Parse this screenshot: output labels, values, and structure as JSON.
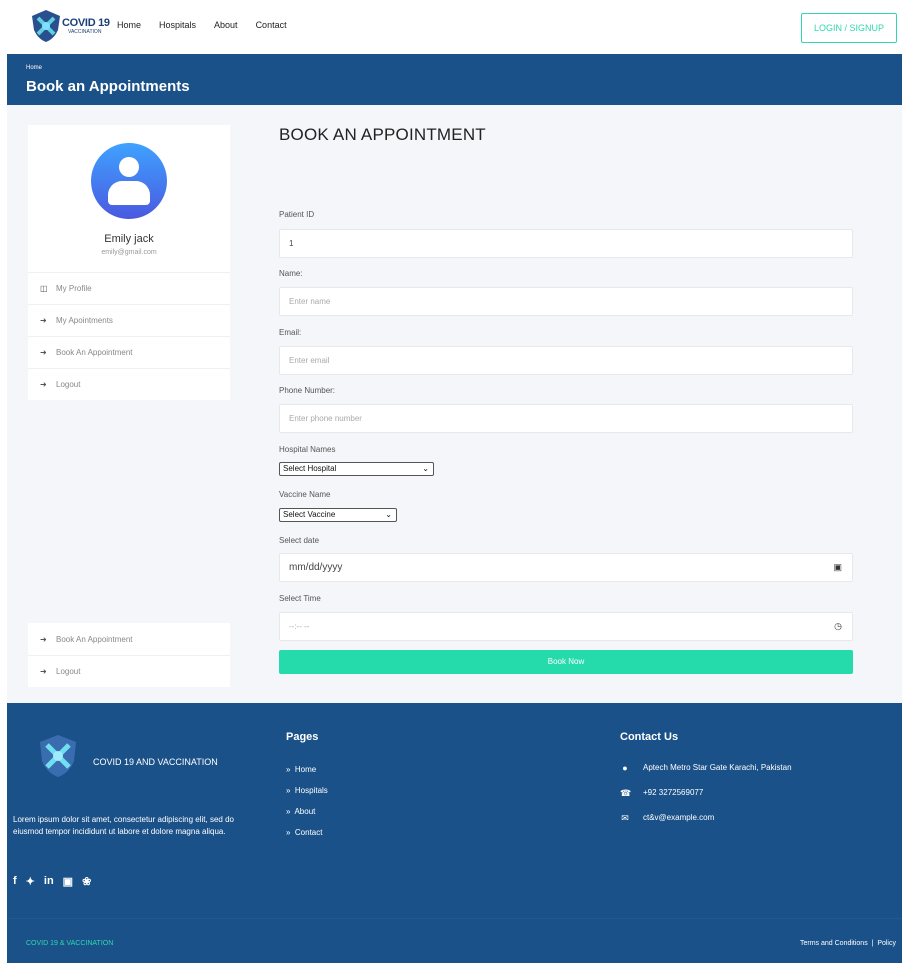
{
  "nav": {
    "logo_text": "COVID 19",
    "logo_sub": "VACCINATION",
    "links": [
      "Home",
      "Hospitals",
      "About",
      "Contact"
    ],
    "login_label": "LOGIN / SIGNUP"
  },
  "banner": {
    "breadcrumb": "Home",
    "title": "Book an Appointments"
  },
  "profile": {
    "name": "Emily jack",
    "email": "emily@gmail.com"
  },
  "sidebar": {
    "items": [
      {
        "label": "My Profile",
        "icon": "columns-icon"
      },
      {
        "label": "My Apointments",
        "icon": "sign-in-icon"
      },
      {
        "label": "Book An Appointment",
        "icon": "sign-in-icon"
      },
      {
        "label": "Logout",
        "icon": "sign-in-icon"
      }
    ],
    "items2": [
      {
        "label": "Book An Appointment",
        "icon": "sign-in-icon"
      },
      {
        "label": "Logout",
        "icon": "sign-in-icon"
      }
    ]
  },
  "form": {
    "title": "BOOK AN APPOINTMENT",
    "patient_id_label": "Patient ID",
    "patient_id_value": "1",
    "name_label": "Name:",
    "name_placeholder": "Enter name",
    "email_label": "Email:",
    "email_placeholder": "Enter email",
    "phone_label": "Phone Number:",
    "phone_placeholder": "Enter phone number",
    "hospital_label": "Hospital Names",
    "hospital_selected": "Select Hospital",
    "vaccine_label": "Vaccine Name",
    "vaccine_selected": "Select Vaccine",
    "date_label": "Select date",
    "date_placeholder": "mm/dd/yyyy",
    "time_label": "Select Time",
    "time_placeholder": "--:-- --",
    "submit_label": "Book Now"
  },
  "footer": {
    "brand": "COVID 19 AND VACCINATION",
    "description": "Lorem ipsum dolor sit amet, consectetur adipiscing elit, sed do eiusmod tempor incididunt ut labore et dolore magna aliqua.",
    "social": [
      "f",
      "twitter",
      "in",
      "instagram",
      "dribbble"
    ],
    "pages_title": "Pages",
    "pages": [
      "Home",
      "Hospitals",
      "About",
      "Contact"
    ],
    "contact_title": "Contact Us",
    "address": "Aptech Metro Star Gate Karachi, Pakistan",
    "phone": "+92 3272569077",
    "email": "ct&v@example.com",
    "copyright": "COVID 19 & VACCINATION",
    "terms": "Terms and Conditions",
    "sep": "|",
    "policy": "Policy"
  },
  "colors": {
    "primary": "#1b5189",
    "accent": "#25dbac",
    "avatar_gradient_top": "#3fa2ff",
    "avatar_gradient_bottom": "#4a59e0"
  }
}
